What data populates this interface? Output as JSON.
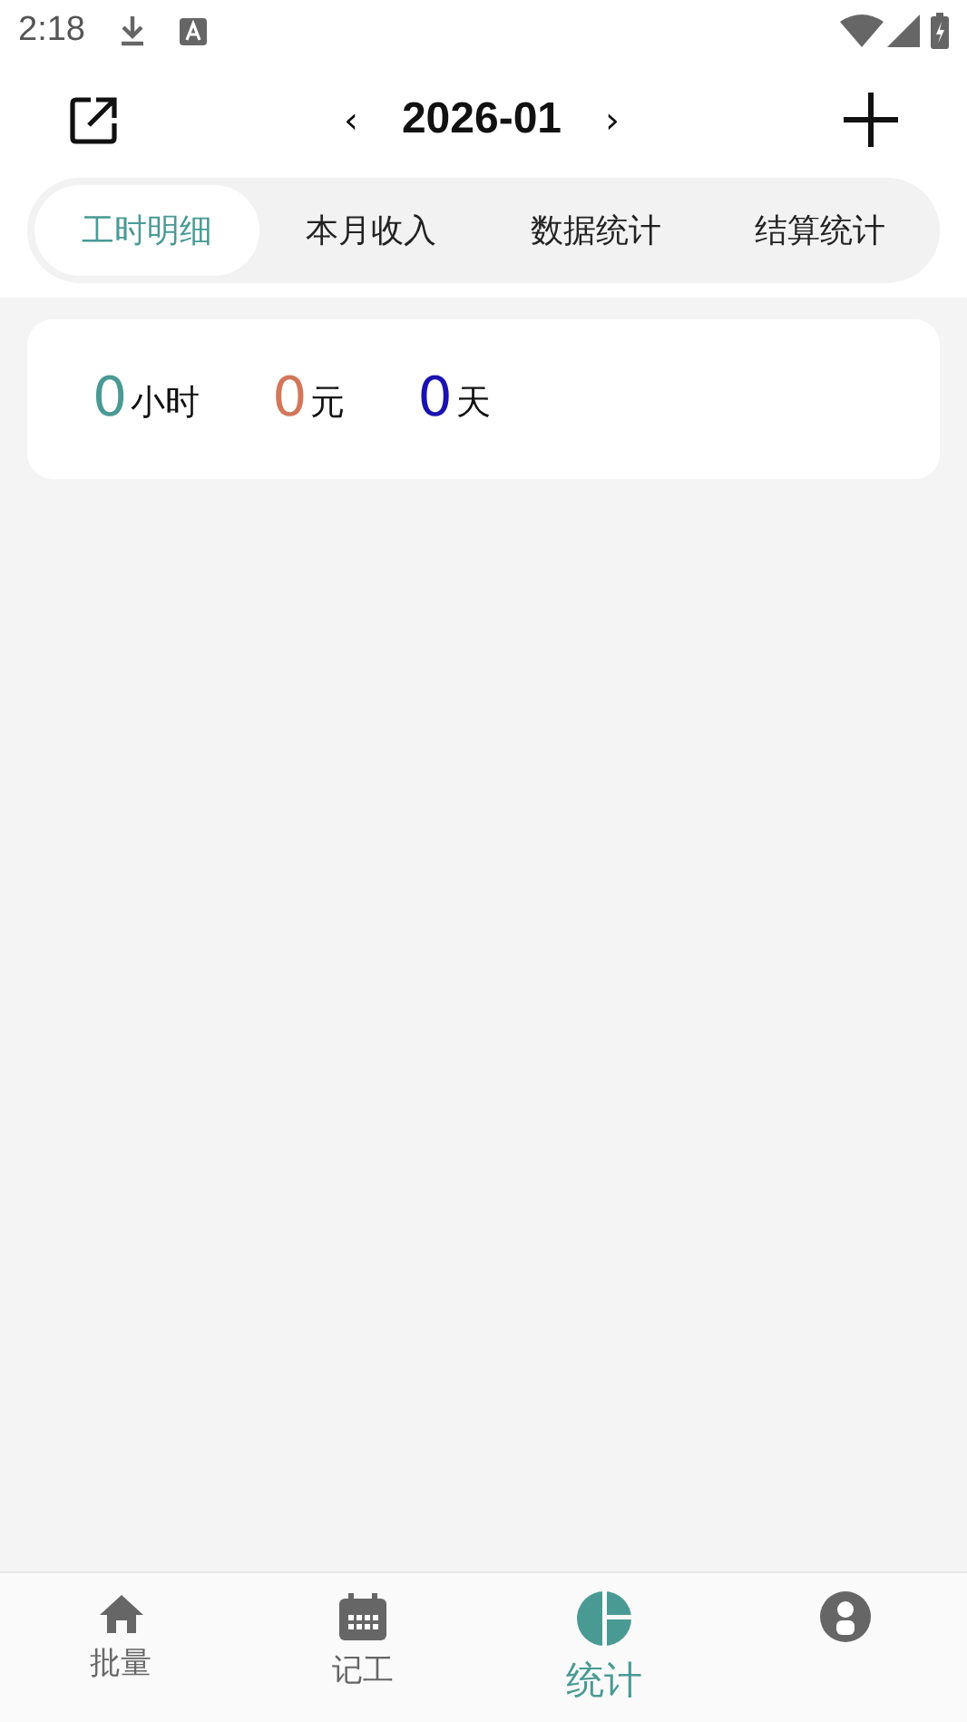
{
  "status_bar": {
    "time": "2:18"
  },
  "header": {
    "month": "2026-01",
    "prev": "‹",
    "next": "›"
  },
  "tabs": [
    {
      "label": "工时明细",
      "selected": true
    },
    {
      "label": "本月收入",
      "selected": false
    },
    {
      "label": "数据统计",
      "selected": false
    },
    {
      "label": "结算统计",
      "selected": false
    }
  ],
  "summary": [
    {
      "value": "0",
      "unit": "小时",
      "color": "#4a9a94"
    },
    {
      "value": "0",
      "unit": "元",
      "color": "#d2775a"
    },
    {
      "value": "0",
      "unit": "天",
      "color": "#1a12b0"
    }
  ],
  "bottom_nav": [
    {
      "kind": "home",
      "label": "批量",
      "selected": false
    },
    {
      "kind": "calendar",
      "label": "记工",
      "selected": false
    },
    {
      "kind": "chart",
      "label": "统计",
      "selected": true
    },
    {
      "kind": "person",
      "selected": false
    }
  ]
}
